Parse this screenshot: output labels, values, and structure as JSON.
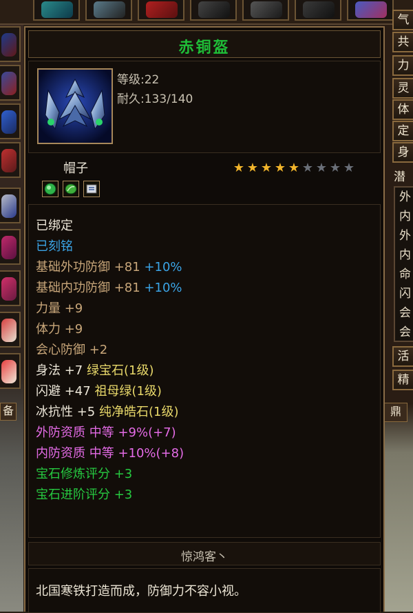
{
  "item": {
    "name": "赤铜盔",
    "level_label": "等级:",
    "level": "22",
    "durability_label": "耐久:",
    "durability": "133/140",
    "type": "帽子",
    "star_rating": 5,
    "star_max": 9,
    "sockets": [
      "green-gem-icon",
      "green-leaf-gem-icon",
      "scroll-icon"
    ],
    "stats": [
      {
        "id": "bound",
        "parts": [
          {
            "t": "已绑定",
            "c": "#ece6d8"
          }
        ]
      },
      {
        "id": "engraved",
        "parts": [
          {
            "t": "已刻铭",
            "c": "#3ba4e6"
          }
        ]
      },
      {
        "id": "base-ext-def",
        "parts": [
          {
            "t": "基础外功防御 +81 ",
            "c": "#c9a77a"
          },
          {
            "t": "+10%",
            "c": "#3ba4e6"
          }
        ]
      },
      {
        "id": "base-int-def",
        "parts": [
          {
            "t": "基础内功防御 +81 ",
            "c": "#c9a77a"
          },
          {
            "t": "+10%",
            "c": "#3ba4e6"
          }
        ]
      },
      {
        "id": "strength",
        "parts": [
          {
            "t": "力量 +9",
            "c": "#c9a77a"
          }
        ]
      },
      {
        "id": "stamina",
        "parts": [
          {
            "t": "体力 +9",
            "c": "#c9a77a"
          }
        ]
      },
      {
        "id": "crit-def",
        "parts": [
          {
            "t": "会心防御 +2",
            "c": "#c9a77a"
          }
        ]
      },
      {
        "id": "agility",
        "parts": [
          {
            "t": "身法 +7 ",
            "c": "#ece6d8"
          },
          {
            "t": "绿宝石(1级)",
            "c": "#e8d86a"
          }
        ]
      },
      {
        "id": "dodge",
        "parts": [
          {
            "t": "闪避 +47 ",
            "c": "#ece6d8"
          },
          {
            "t": "祖母绿(1级)",
            "c": "#e8d86a"
          }
        ]
      },
      {
        "id": "ice-res",
        "parts": [
          {
            "t": "冰抗性 +5 ",
            "c": "#ece6d8"
          },
          {
            "t": "纯净皓石(1级)",
            "c": "#e8d86a"
          }
        ]
      },
      {
        "id": "ext-quality",
        "parts": [
          {
            "t": "外防资质   中等 +9%(+7)",
            "c": "#e46be6"
          }
        ]
      },
      {
        "id": "int-quality",
        "parts": [
          {
            "t": "内防资质   中等 +10%(+8)",
            "c": "#e46be6"
          }
        ]
      },
      {
        "id": "gem-refine",
        "parts": [
          {
            "t": "宝石修炼评分 +3",
            "c": "#26c940"
          }
        ]
      },
      {
        "id": "gem-advance",
        "parts": [
          {
            "t": "宝石进阶评分 +3",
            "c": "#26c940"
          }
        ]
      }
    ],
    "maker": "惊鸿客丶",
    "description": "北国寒铁打造而成，防御力不容小视。"
  },
  "right_tabs": [
    "气",
    "共",
    "力",
    "灵",
    "体",
    "定",
    "身",
    "潜"
  ],
  "right_inner": [
    "外",
    "内",
    "外",
    "内",
    "命",
    "闪",
    "会",
    "会"
  ],
  "right_lower_tabs": [
    "活",
    "精"
  ],
  "left_tab": "备",
  "right_side_tab": "鼎",
  "colors": {
    "title": "#1fbf38",
    "star_on": "#f2b52b",
    "star_off": "#6a6f78",
    "border": "#8a6d47"
  }
}
